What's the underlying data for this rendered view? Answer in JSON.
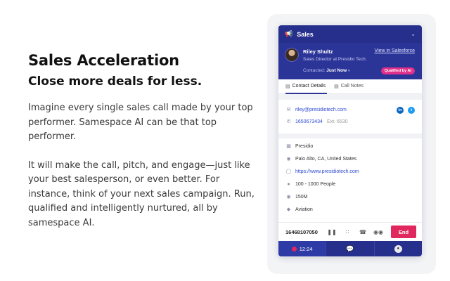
{
  "hero": {
    "title": "Sales Acceleration",
    "subtitle": "Close more deals for less.",
    "paragraph1": "Imagine every single sales call made by your top performer. Samespace AI can be that top performer.",
    "paragraph2": "It will make the call, pitch, and engage—just like your best salesperson, or even better. For instance, think of your next sales campaign. Run, qualified and intelligently nurtured, all by samespace AI."
  },
  "widget": {
    "header_title": "Sales",
    "contact": {
      "name": "Riley Shultz",
      "title": "Sales Director at Presidio Tech.",
      "view_link": "View in Salesforce",
      "contacted_label": "Contacted:",
      "contacted_value": "Just Now",
      "badge": "Qualified by AI"
    },
    "tabs": [
      {
        "label": "Contact Details",
        "active": true
      },
      {
        "label": "Call Notes",
        "active": false
      }
    ],
    "details": {
      "email": "riley@presidiotech.com",
      "phone": "1650673434",
      "ext": "Ext. 6530"
    },
    "company": {
      "name": "Presidio",
      "location": "Palo Alto, CA, United States",
      "website": "https://www.presidiotech.com",
      "employees": "100 - 1000 People",
      "revenue": "150M",
      "industry": "Aviation"
    },
    "call": {
      "number": "16468107050",
      "end_label": "End",
      "timer": "12:24"
    },
    "colors": {
      "header": "#272f8c",
      "accent": "#2b3497",
      "end": "#e0275e",
      "badge": "#e0308b"
    }
  }
}
